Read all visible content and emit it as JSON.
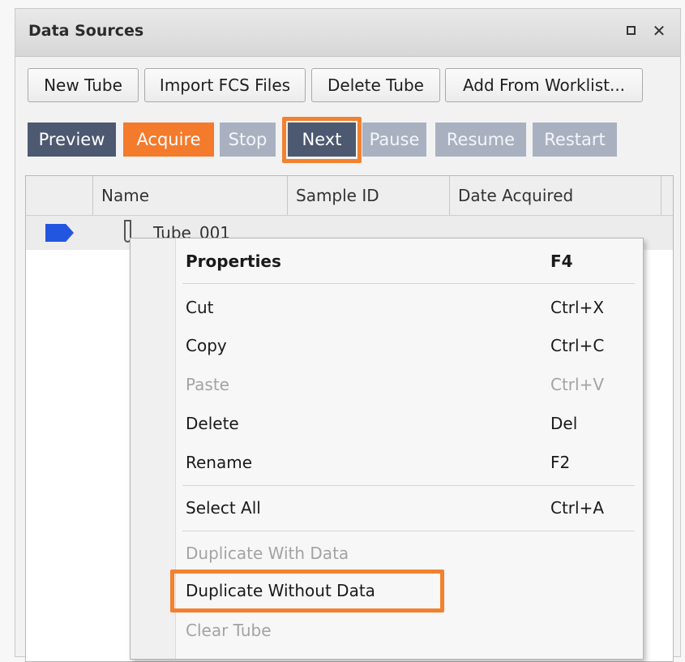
{
  "window": {
    "title": "Data Sources"
  },
  "toolbar": {
    "new_tube": "New Tube",
    "import_fcs": "Import FCS Files",
    "delete_tube": "Delete Tube",
    "add_from_worklist": "Add From Worklist..."
  },
  "controls": {
    "preview": "Preview",
    "acquire": "Acquire",
    "stop": "Stop",
    "next": "Next",
    "pause": "Pause",
    "resume": "Resume",
    "restart": "Restart"
  },
  "grid": {
    "columns": [
      "Name",
      "Sample ID",
      "Date Acquired"
    ],
    "rows": [
      {
        "name": "Tube_001",
        "sample_id": "",
        "date_acquired": ""
      }
    ]
  },
  "context_menu": {
    "items": [
      {
        "label": "Properties",
        "shortcut": "F4",
        "state": "bold"
      },
      {
        "label": "Cut",
        "shortcut": "Ctrl+X",
        "state": "enabled"
      },
      {
        "label": "Copy",
        "shortcut": "Ctrl+C",
        "state": "enabled"
      },
      {
        "label": "Paste",
        "shortcut": "Ctrl+V",
        "state": "disabled"
      },
      {
        "label": "Delete",
        "shortcut": "Del",
        "state": "enabled"
      },
      {
        "label": "Rename",
        "shortcut": "F2",
        "state": "enabled"
      },
      {
        "label": "Select All",
        "shortcut": "Ctrl+A",
        "state": "enabled"
      },
      {
        "label": "Duplicate With Data",
        "shortcut": "",
        "state": "disabled"
      },
      {
        "label": "Duplicate Without Data",
        "shortcut": "",
        "state": "enabled"
      },
      {
        "label": "Clear Tube",
        "shortcut": "",
        "state": "disabled"
      }
    ]
  },
  "colors": {
    "acquire": "#f47a2c",
    "control_active": "#4d5971",
    "control_disabled": "#a9b1c1",
    "highlight": "#f3812f",
    "tube_marker": "#2356e0"
  }
}
